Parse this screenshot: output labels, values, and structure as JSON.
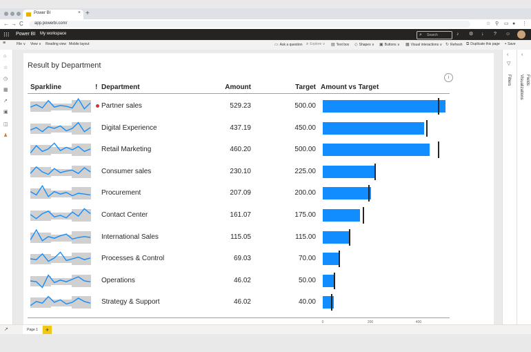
{
  "browser": {
    "tab_title": "Power BI",
    "tab_close": "×",
    "new_tab": "+",
    "url": "app.powerbi.com/",
    "nav": {
      "back": "←",
      "forward": "→",
      "reload": "C"
    },
    "icons": [
      "star-icon",
      "extension-icon",
      "cast-icon",
      "profile-icon",
      "kebab-menu-icon"
    ]
  },
  "pbi_header": {
    "waffle": "⋮⋮⋮",
    "brand": "Power BI",
    "workspace": "My workspace",
    "search_placeholder": "Search",
    "icons": [
      "bell-icon",
      "gear-icon",
      "download-icon",
      "help-icon",
      "feedback-icon"
    ]
  },
  "ribbon": {
    "file": "File ∨",
    "view": "View ∨",
    "reading_view": "Reading view",
    "mobile_layout": "Mobile layout",
    "ask_question": "Ask a question",
    "explore": "Explore ∨",
    "text_box": "Text box",
    "shapes": "Shapes ∨",
    "buttons": "Buttons ∨",
    "visual_interactions": "Visual interactions ∨",
    "refresh": "Refresh",
    "duplicate_page": "Duplicate this page",
    "save": "Save"
  },
  "report": {
    "title": "Result by Department",
    "info": "i",
    "headers": {
      "sparkline": "Sparkline",
      "alert": "!",
      "department": "Department",
      "amount": "Amount",
      "target": "Target",
      "amount_vs_target": "Amount vs Target"
    },
    "axis_ticks": [
      "0",
      "200",
      "400"
    ],
    "rows": [
      {
        "department": "Partner sales",
        "amount": "529.23",
        "target": "500.00"
      },
      {
        "department": "Digital Experience",
        "amount": "437.19",
        "target": "450.00"
      },
      {
        "department": "Retail Marketing",
        "amount": "460.20",
        "target": "500.00"
      },
      {
        "department": "Consumer sales",
        "amount": "230.10",
        "target": "225.00"
      },
      {
        "department": "Procurement",
        "amount": "207.09",
        "target": "200.00"
      },
      {
        "department": "Contact Center",
        "amount": "161.07",
        "target": "175.00"
      },
      {
        "department": "International Sales",
        "amount": "115.05",
        "target": "115.00"
      },
      {
        "department": "Processes & Control",
        "amount": "69.03",
        "target": "70.00"
      },
      {
        "department": "Operations",
        "amount": "46.02",
        "target": "50.00"
      },
      {
        "department": "Strategy & Support",
        "amount": "46.02",
        "target": "40.00"
      }
    ]
  },
  "chart_data": {
    "type": "bar",
    "categories": [
      "Partner sales",
      "Digital Experience",
      "Retail Marketing",
      "Consumer sales",
      "Procurement",
      "Contact Center",
      "International Sales",
      "Processes & Control",
      "Operations",
      "Strategy & Support"
    ],
    "series": [
      {
        "name": "Amount",
        "values": [
          529.23,
          437.19,
          460.2,
          230.1,
          207.09,
          161.07,
          115.05,
          69.03,
          46.02,
          46.02
        ]
      },
      {
        "name": "Target",
        "values": [
          500,
          450,
          500,
          225,
          200,
          175,
          115,
          70,
          50,
          40
        ]
      }
    ],
    "xlim": [
      0,
      530
    ],
    "x_ticks": [
      0,
      200,
      400
    ],
    "alerts": [
      "Partner sales"
    ],
    "sparklines": [
      [
        0.45,
        0.6,
        0.4,
        0.85,
        0.45,
        0.55,
        0.5,
        0.4,
        0.95,
        0.35,
        0.7
      ],
      [
        0.4,
        0.55,
        0.3,
        0.6,
        0.5,
        0.65,
        0.35,
        0.5,
        0.85,
        0.3,
        0.55
      ],
      [
        0.3,
        0.75,
        0.4,
        0.55,
        0.9,
        0.45,
        0.65,
        0.5,
        0.7,
        0.4,
        0.55
      ],
      [
        0.4,
        0.8,
        0.5,
        0.35,
        0.7,
        0.45,
        0.55,
        0.6,
        0.4,
        0.75,
        0.5
      ],
      [
        0.6,
        0.4,
        0.95,
        0.3,
        0.6,
        0.45,
        0.55,
        0.35,
        0.5,
        0.45,
        0.4
      ],
      [
        0.55,
        0.3,
        0.6,
        0.75,
        0.4,
        0.5,
        0.35,
        0.7,
        0.45,
        0.9,
        0.6
      ],
      [
        0.35,
        0.95,
        0.3,
        0.55,
        0.45,
        0.6,
        0.7,
        0.4,
        0.5,
        0.55,
        0.5
      ],
      [
        0.5,
        0.45,
        0.8,
        0.35,
        0.55,
        0.9,
        0.4,
        0.5,
        0.6,
        0.45,
        0.55
      ],
      [
        0.5,
        0.45,
        0.1,
        0.85,
        0.4,
        0.55,
        0.45,
        0.6,
        0.75,
        0.5,
        0.45
      ],
      [
        0.3,
        0.55,
        0.45,
        0.85,
        0.5,
        0.65,
        0.4,
        0.5,
        0.75,
        0.55,
        0.45
      ]
    ]
  },
  "right_panes": {
    "filters": "Filters",
    "visualizations": "Visualizations",
    "fields": "Fields",
    "collapse": "‹"
  },
  "page_tabs": {
    "current": "Page 1",
    "add": "+",
    "expand": "↗"
  },
  "colors": {
    "bar": "#118dff",
    "header_bg": "#252423",
    "alert": "#d13438",
    "accent": "#f2c811",
    "sparkline_band": "#d0d0d0"
  }
}
